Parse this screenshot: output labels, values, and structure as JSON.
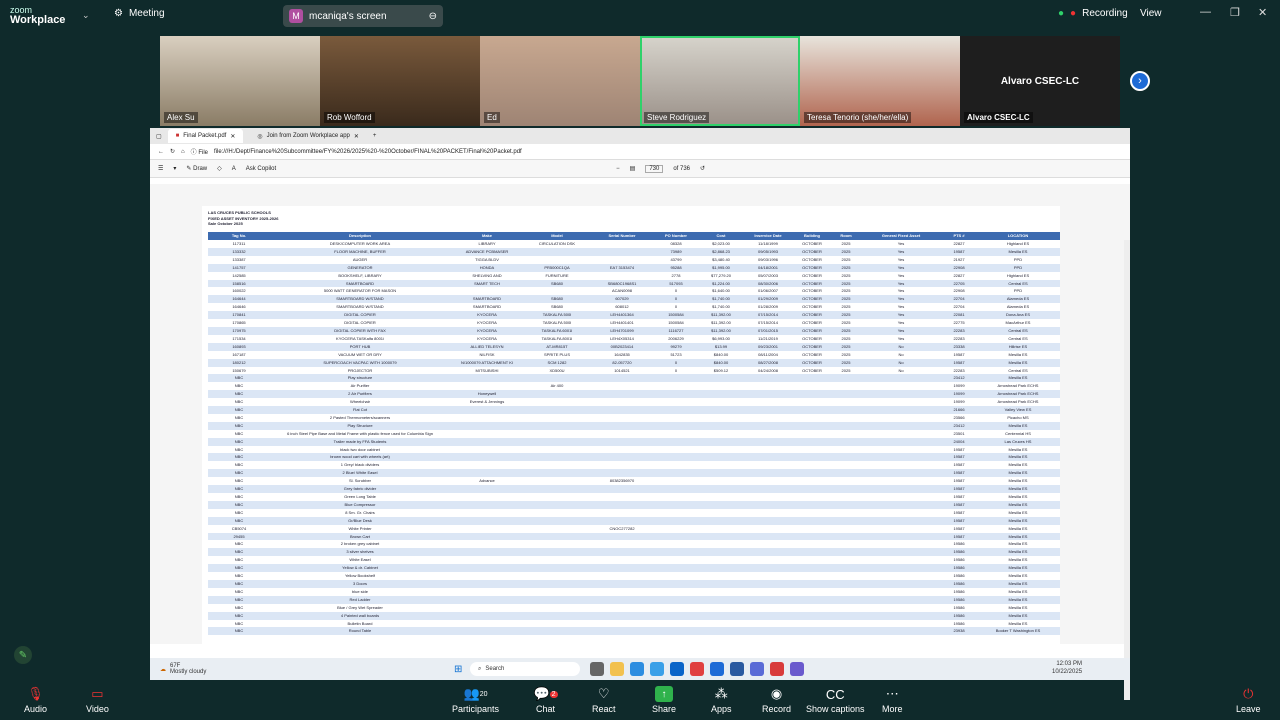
{
  "app": {
    "brand_line1": "zoom",
    "brand_line2": "Workplace",
    "meeting_label": "Meeting",
    "share_label": "mcaniqa's screen",
    "recording_label": "Recording",
    "view_label": "View"
  },
  "participants": [
    {
      "name": "Alex Su"
    },
    {
      "name": "Rob Wofford"
    },
    {
      "name": "Ed"
    },
    {
      "name": "Steve Rodriguez"
    },
    {
      "name": "Teresa Tenorio (she/her/ella)"
    },
    {
      "name": "Alvaro CSEC-LC",
      "tile_text": "Alvaro CSEC-LC"
    }
  ],
  "browser": {
    "tabs": [
      "Final Packet.pdf",
      "Join from Zoom Workplace app"
    ],
    "address": "file:///H:/Dept/Finance%20Subcommittee/FY%2026/2025%20-%20October/FINAL%20PACKET/Final%20Packet.pdf",
    "pdf_tools": {
      "draw": "Draw",
      "copilot": "Ask Copilot",
      "page": "730",
      "page_total": "of 736"
    }
  },
  "document": {
    "title1": "LAS CRUCES PUBLIC SCHOOLS",
    "title2": "FIXED ASSET INVENTORY 2025-2026",
    "title3": "Sale October 2025",
    "columns": [
      "Tag No.",
      "Description",
      "Make",
      "Model",
      "Serial Number",
      "PO Number",
      "Cost",
      "Inservice Date",
      "Building",
      "Room",
      "General Fixed Asset",
      "PTS #",
      "LOCATION"
    ],
    "rows": [
      [
        "117311",
        "DESK/COMPUTER WORK AREA",
        "LIBRARY",
        "CIRCULATION DSK",
        "",
        "08328",
        "$2,023.00",
        "11/18/1999",
        "OCTOBER",
        "2025",
        "Yes",
        "22827",
        "Highland ES"
      ],
      [
        "133332",
        "FLOOR MACHINE, BUFFER",
        "ADVANCE PCBMASER",
        "",
        "",
        "73989",
        "$2,868.23",
        "09/05/1993",
        "OCTOBER",
        "2025",
        "Yes",
        "19587",
        "Mesilla ES"
      ],
      [
        "133387",
        "AUGER",
        "TIGGA BLDV",
        "",
        "",
        "43799",
        "$3,480.40",
        "09/03/1996",
        "OCTOBER",
        "2025",
        "Yes",
        "21927",
        "PPD"
      ],
      [
        "141757",
        "GENERATOR",
        "HONDA",
        "PR5000C1QA",
        "EA7 3153474",
        "95288",
        "$1,995.00",
        "04/18/2001",
        "OCTOBER",
        "2025",
        "Yes",
        "22908",
        "PPD"
      ],
      [
        "142585",
        "BOOKSHELF, LIBRARY",
        "SHELVING AND",
        "FURNITURE",
        "",
        "2778",
        "$77,279.20",
        "05/07/2003",
        "OCTOBER",
        "2025",
        "Yes",
        "22827",
        "Highland ES"
      ],
      [
        "158516",
        "SMARTBOARD",
        "SMART TECH",
        "SB680",
        "SB680C1968S1",
        "517093",
        "$1,224.00",
        "08/30/2006",
        "OCTOBER",
        "2025",
        "Yes",
        "22705",
        "Central ES"
      ],
      [
        "160022",
        "5000 WATT GENERATOR FOR MASON",
        "",
        "",
        "ACAN0098",
        "0",
        "$1,640.00",
        "01/06/2007",
        "OCTOBER",
        "2025",
        "Yes",
        "22908",
        "PPD"
      ],
      [
        "164644",
        "SMARTBOARD W/STAND",
        "SMARTBOARD",
        "SB680",
        "607029",
        "0",
        "$1,740.00",
        "01/29/2009",
        "OCTOBER",
        "2025",
        "Yes",
        "22704",
        "Alameda ES"
      ],
      [
        "164646",
        "SMARTBOARD W/STAND",
        "SMARTBOARD",
        "SB680",
        "608012",
        "0",
        "$1,740.00",
        "01/28/2009",
        "OCTOBER",
        "2025",
        "Yes",
        "22704",
        "Alameda ES"
      ],
      [
        "170841",
        "DIGITAL COPIER",
        "KYOCERA",
        "TASKALFA 500I",
        "LEH4401364",
        "1500584",
        "$11,392.00",
        "07/15/2014",
        "OCTOBER",
        "2025",
        "Yes",
        "22081",
        "Dona Ana ES"
      ],
      [
        "170865",
        "DIGITAL COPIER",
        "KYOCERA",
        "TASKALFA 500I",
        "LEH4401401",
        "1500584",
        "$11,392.00",
        "07/15/2014",
        "OCTOBER",
        "2025",
        "Yes",
        "22775",
        "MacArthur ES"
      ],
      [
        "170975",
        "DIGITAL COPIER WITH FAX",
        "KYOCERA",
        "TASKALFA 6001I",
        "LEH4701099",
        "1116727",
        "$11,392.00",
        "07/01/2015",
        "OCTOBER",
        "2025",
        "Yes",
        "22283",
        "Central ES"
      ],
      [
        "171534",
        "KYOCERA TASKalfa 8001i",
        "KYOCERA",
        "TASKALFA 8001I",
        "LEH4X05314",
        "2006229",
        "$6,993.00",
        "11/21/2019",
        "OCTOBER",
        "2025",
        "Yes",
        "22283",
        "Central ES"
      ],
      [
        "160893",
        "PORT HUB",
        "ALLIED TELESYN",
        "AT-MR815T",
        "00B2023414",
        "99279",
        "$13.99",
        "09/23/2001",
        "OCTOBER",
        "2025",
        "No",
        "23338",
        "Hillrise ES"
      ],
      [
        "167187",
        "VACUUM WET OR DRY",
        "NILFISK",
        "SPRITE PLUS",
        "1642835",
        "51723",
        "$840.00",
        "08/11/2004",
        "OCTOBER",
        "2025",
        "No",
        "19587",
        "Mesilla ES"
      ],
      [
        "180212",
        "SUPERCOACH VACPAC WITH 1000079",
        "N/1000079 ATTACHMENT KI",
        "SCM 1282",
        "82-057720",
        "0",
        "$840.00",
        "08/27/2008",
        "OCTOBER",
        "2025",
        "No",
        "19587",
        "Mesilla ES"
      ],
      [
        "150679",
        "PROJECTOR",
        "MITSUBISHI",
        "XD500U",
        "1014521",
        "0",
        "$509.12",
        "04/24/2008",
        "OCTOBER",
        "2025",
        "No",
        "22283",
        "Central ES"
      ],
      [
        "NBC",
        "Play structure",
        "",
        "",
        "",
        "",
        "",
        "",
        "",
        "",
        "",
        "23412",
        "Mesilla ES"
      ],
      [
        "NBC",
        "Air Purifier",
        "",
        "Air 400",
        "",
        "",
        "",
        "",
        "",
        "",
        "",
        "19099",
        "Arrowhead Park ECHS"
      ],
      [
        "NBC",
        "2 Air Purifiers",
        "Honeywell",
        "",
        "",
        "",
        "",
        "",
        "",
        "",
        "",
        "19099",
        "Arrowhead Park ECHS"
      ],
      [
        "NBC",
        "Wheelchair",
        "Everest & Jennings",
        "",
        "",
        "",
        "",
        "",
        "",
        "",
        "",
        "19099",
        "Arrowhead Park ECHS"
      ],
      [
        "NBC",
        "Flat Cot",
        "",
        "",
        "",
        "",
        "",
        "",
        "",
        "",
        "",
        "21666",
        "Valley View ES"
      ],
      [
        "NBC",
        "2 Pasted Thermometers/scanners",
        "",
        "",
        "",
        "",
        "",
        "",
        "",
        "",
        "",
        "23566",
        "Picacho MS"
      ],
      [
        "NBC",
        "Play Structure",
        "",
        "",
        "",
        "",
        "",
        "",
        "",
        "",
        "",
        "23412",
        "Mesilla ES"
      ],
      [
        "NBC",
        "6 inch Steel Pipe Base and Metal Frame with plastic fence used for Columbia Sign",
        "",
        "",
        "",
        "",
        "",
        "",
        "",
        "",
        "",
        "23501",
        "Centennial HS"
      ],
      [
        "NBC",
        "Trailer made by FFA Students",
        "",
        "",
        "",
        "",
        "",
        "",
        "",
        "",
        "",
        "24004",
        "Las Cruces HS"
      ],
      [
        "NBC",
        "black two door cabinet",
        "",
        "",
        "",
        "",
        "",
        "",
        "",
        "",
        "",
        "19587",
        "Mesilla ES"
      ],
      [
        "NBC",
        "brown wood cart with wheels (art)",
        "",
        "",
        "",
        "",
        "",
        "",
        "",
        "",
        "",
        "19587",
        "Mesilla ES"
      ],
      [
        "NBC",
        "1 Grey/ black dividers",
        "",
        "",
        "",
        "",
        "",
        "",
        "",
        "",
        "",
        "19587",
        "Mesilla ES"
      ],
      [
        "NBC",
        "2 Blue/ White Easel",
        "",
        "",
        "",
        "",
        "",
        "",
        "",
        "",
        "",
        "19587",
        "Mesilla ES"
      ],
      [
        "NBC",
        "Sl. Scrubber",
        "Advance",
        "",
        "80382356970",
        "",
        "",
        "",
        "",
        "",
        "",
        "19587",
        "Mesilla ES"
      ],
      [
        "NBC",
        "Grey fabric divider",
        "",
        "",
        "",
        "",
        "",
        "",
        "",
        "",
        "",
        "19587",
        "Mesilla ES"
      ],
      [
        "NBC",
        "Green Long Table",
        "",
        "",
        "",
        "",
        "",
        "",
        "",
        "",
        "",
        "19587",
        "Mesilla ES"
      ],
      [
        "NBC",
        "Blue Compressor",
        "",
        "",
        "",
        "",
        "",
        "",
        "",
        "",
        "",
        "19587",
        "Mesilla ES"
      ],
      [
        "NBC",
        "8 Sm. Gr. Chairs",
        "",
        "",
        "",
        "",
        "",
        "",
        "",
        "",
        "",
        "19587",
        "Mesilla ES"
      ],
      [
        "NBC",
        "Gr/Blue Desk",
        "",
        "",
        "",
        "",
        "",
        "",
        "",
        "",
        "",
        "19587",
        "Mesilla ES"
      ],
      [
        "CB5074",
        "White Printer",
        "",
        "",
        "CNOC277282",
        "",
        "",
        "",
        "",
        "",
        "",
        "19587",
        "Mesilla ES"
      ],
      [
        "29455",
        "Brown Cart",
        "",
        "",
        "",
        "",
        "",
        "",
        "",
        "",
        "",
        "19587",
        "Mesilla ES"
      ],
      [
        "NBC",
        "2 broken grey cabinet",
        "",
        "",
        "",
        "",
        "",
        "",
        "",
        "",
        "",
        "19586",
        "Mesilla ES"
      ],
      [
        "NBC",
        "3 silver shelves",
        "",
        "",
        "",
        "",
        "",
        "",
        "",
        "",
        "",
        "19586",
        "Mesilla ES"
      ],
      [
        "NBC",
        "White Easel",
        "",
        "",
        "",
        "",
        "",
        "",
        "",
        "",
        "",
        "19586",
        "Mesilla ES"
      ],
      [
        "NBC",
        "Yellow & dr. Cabinet",
        "",
        "",
        "",
        "",
        "",
        "",
        "",
        "",
        "",
        "19586",
        "Mesilla ES"
      ],
      [
        "NBC",
        "Yellow Bookshelf",
        "",
        "",
        "",
        "",
        "",
        "",
        "",
        "",
        "",
        "19586",
        "Mesilla ES"
      ],
      [
        "NBC",
        "3 Doors",
        "",
        "",
        "",
        "",
        "",
        "",
        "",
        "",
        "",
        "19586",
        "Mesilla ES"
      ],
      [
        "NBC",
        "blue side",
        "",
        "",
        "",
        "",
        "",
        "",
        "",
        "",
        "",
        "19586",
        "Mesilla ES"
      ],
      [
        "NBC",
        "Red Ladder",
        "",
        "",
        "",
        "",
        "",
        "",
        "",
        "",
        "",
        "19586",
        "Mesilla ES"
      ],
      [
        "NBC",
        "Blue / Grey Wet Spreader",
        "",
        "",
        "",
        "",
        "",
        "",
        "",
        "",
        "",
        "19586",
        "Mesilla ES"
      ],
      [
        "NBC",
        "4 Painted wall boards",
        "",
        "",
        "",
        "",
        "",
        "",
        "",
        "",
        "",
        "19586",
        "Mesilla ES"
      ],
      [
        "NBC",
        "Bulletin Board",
        "",
        "",
        "",
        "",
        "",
        "",
        "",
        "",
        "",
        "19586",
        "Mesilla ES"
      ],
      [
        "NBC",
        "Round Table",
        "",
        "",
        "",
        "",
        "",
        "",
        "",
        "",
        "",
        "23938",
        "Booker T Washington ES"
      ]
    ]
  },
  "taskbar": {
    "weather_temp": "67F",
    "weather_desc": "Mostly cloudy",
    "search": "Search",
    "time": "12:03 PM",
    "date": "10/22/2025"
  },
  "controls": {
    "audio": "Audio",
    "video": "Video",
    "participants": "Participants",
    "participants_count": "20",
    "chat": "Chat",
    "chat_badge": "2",
    "react": "React",
    "share": "Share",
    "apps": "Apps",
    "record": "Record",
    "captions": "Show captions",
    "more": "More",
    "leave": "Leave"
  }
}
